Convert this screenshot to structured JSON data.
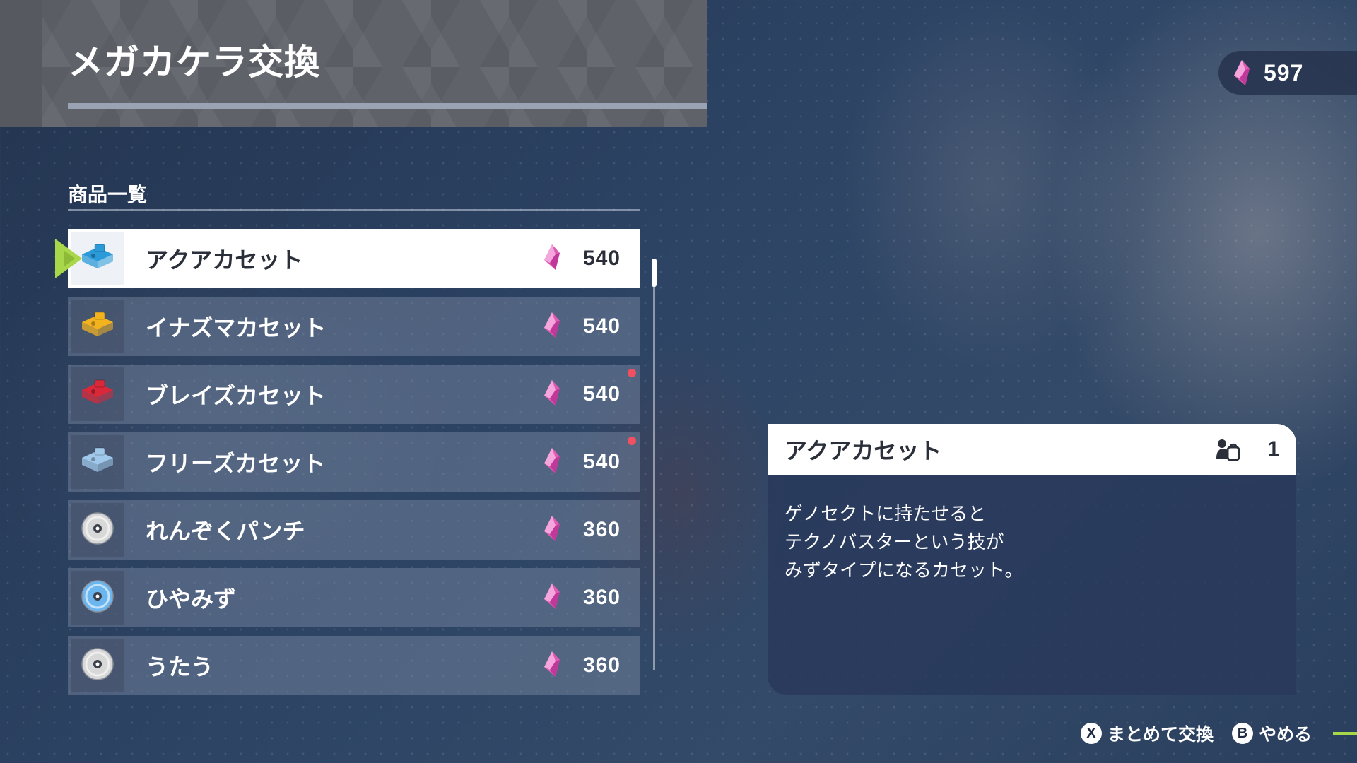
{
  "header": {
    "title": "メガカケラ交換"
  },
  "currency": {
    "icon": "mega-shard-gem-icon",
    "value": "597"
  },
  "list": {
    "heading": "商品一覧",
    "items": [
      {
        "name": "アクアカセット",
        "price": "540",
        "icon": "aqua-cassette-icon",
        "icon_color": "#2a9ad8",
        "selected": true,
        "new": false
      },
      {
        "name": "イナズマカセット",
        "price": "540",
        "icon": "shock-cassette-icon",
        "icon_color": "#f2b31f",
        "selected": false,
        "new": false
      },
      {
        "name": "ブレイズカセット",
        "price": "540",
        "icon": "blaze-cassette-icon",
        "icon_color": "#d8283a",
        "selected": false,
        "new": true
      },
      {
        "name": "フリーズカセット",
        "price": "540",
        "icon": "freeze-cassette-icon",
        "icon_color": "#9fc8ea",
        "selected": false,
        "new": true
      },
      {
        "name": "れんぞくパンチ",
        "price": "360",
        "icon": "disc-icon",
        "icon_color": "#d8d8d8",
        "selected": false,
        "new": false
      },
      {
        "name": "ひやみず",
        "price": "360",
        "icon": "disc-icon",
        "icon_color": "#6cb6f0",
        "selected": false,
        "new": false
      },
      {
        "name": "うたう",
        "price": "360",
        "icon": "disc-icon",
        "icon_color": "#d8d8d8",
        "selected": false,
        "new": false
      }
    ]
  },
  "detail": {
    "name": "アクアカセット",
    "owned_icon": "bag-owned-icon",
    "count": "1",
    "description": [
      "ゲノセクトに持たせると",
      "テクノバスターという技が",
      "みずタイプになるカセット。"
    ]
  },
  "footer": {
    "x_button": "X",
    "x_label": "まとめて交換",
    "b_button": "B",
    "b_label": "やめる"
  },
  "colors": {
    "accent_cursor": "#a8d84a",
    "gem_pink": "#e05cb4",
    "new_dot": "#f05060"
  }
}
